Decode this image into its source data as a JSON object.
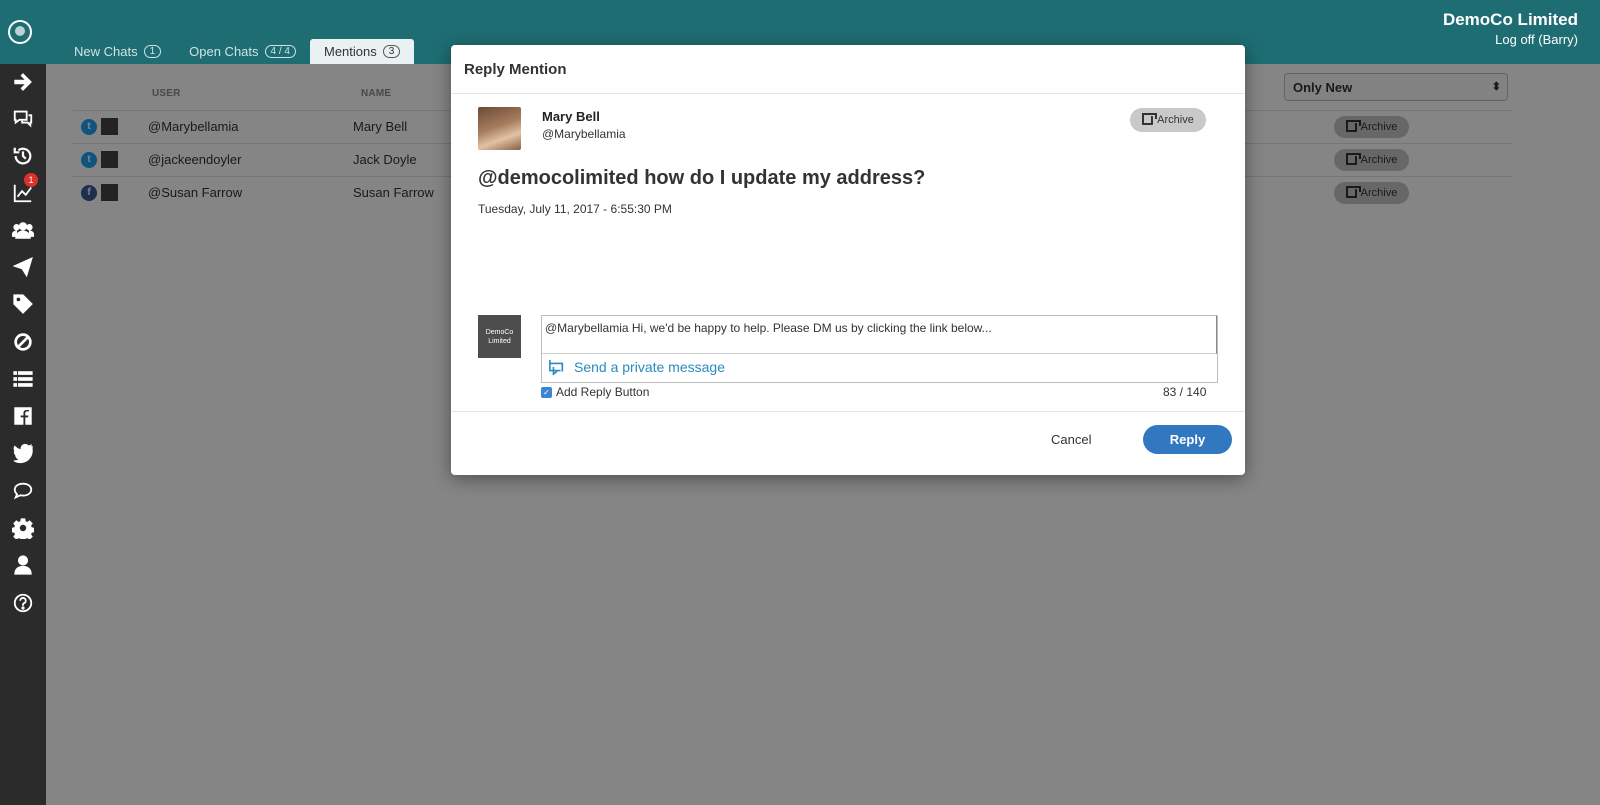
{
  "header": {
    "company": "DemoCo Limited",
    "logoff": "Log off (Barry)",
    "tabs": [
      {
        "label": "New Chats",
        "count": "1"
      },
      {
        "label": "Open Chats",
        "count": "4 / 4"
      },
      {
        "label": "Mentions",
        "count": "3"
      }
    ]
  },
  "sidebar": {
    "notification_count": "1",
    "icons": [
      "arrow-right-icon",
      "chat-bubbles-icon",
      "history-icon",
      "line-chart-icon",
      "users-icon",
      "paper-plane-icon",
      "tag-icon",
      "ban-icon",
      "list-icon",
      "facebook-icon",
      "twitter-icon",
      "speech-bubble-icon",
      "gear-icon",
      "person-icon",
      "help-icon"
    ]
  },
  "filter": {
    "selected": "Only New"
  },
  "table": {
    "columns": [
      "USER",
      "NAME"
    ],
    "rows": [
      {
        "network": "twitter",
        "user": "@Marybellamia",
        "name": "Mary Bell",
        "action": "Archive"
      },
      {
        "network": "twitter",
        "user": "@jackeendoyler",
        "name": "Jack Doyle",
        "action": "Archive"
      },
      {
        "network": "facebook",
        "user": "@Susan Farrow",
        "name": "Susan Farrow",
        "action": "Archive"
      }
    ]
  },
  "modal": {
    "title": "Reply Mention",
    "author_name": "Mary Bell",
    "author_handle": "@Marybellamia",
    "archive_label": "Archive",
    "message": "@democolimited how do I update my address?",
    "timestamp": "Tuesday, July 11, 2017 - 6:55:30 PM",
    "company_avatar_line1": "DemoCo",
    "company_avatar_line2": "Limited",
    "reply_text": "@Marybellamia Hi, we'd be happy to help. Please DM us by clicking the link below...",
    "private_message_label": "Send a private message",
    "add_reply_button_label": "Add Reply Button",
    "char_counter": "83 / 140",
    "cancel_label": "Cancel",
    "reply_label": "Reply"
  },
  "colors": {
    "header_bg": "#1e6d72",
    "sidebar_bg": "#2b2b2b",
    "primary_button": "#3178c0",
    "link": "#2a8bbf",
    "badge": "#d9312b",
    "twitter": "#1da1f2",
    "facebook": "#3b5998"
  }
}
